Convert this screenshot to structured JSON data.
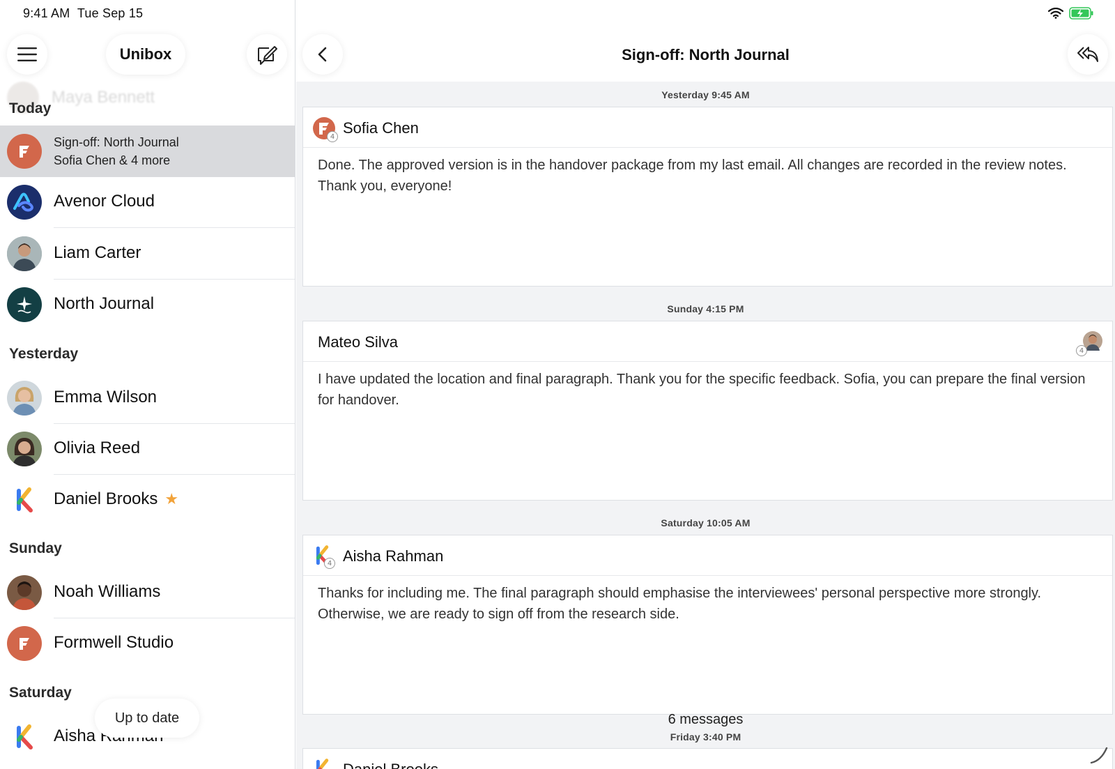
{
  "status_bar": {
    "time": "9:41 AM",
    "date": "Tue Sep 15",
    "wifi_icon": "wifi-icon",
    "battery_icon": "battery-charging-icon"
  },
  "sidebar": {
    "title": "Unibox",
    "menu_icon": "hamburger-menu-icon",
    "compose_icon": "compose-icon",
    "ghost_row_name": "Maya Bennett",
    "sections": {
      "today": "Today",
      "yesterday": "Yesterday",
      "sunday": "Sunday",
      "saturday": "Saturday"
    },
    "selected_thread": {
      "subject": "Sign-off: North Journal",
      "participants": "Sofia Chen & 4 more"
    },
    "items": [
      "Avenor Cloud",
      "Liam Carter",
      "North Journal",
      "Emma Wilson",
      "Olivia Reed",
      "Daniel Brooks",
      "Noah Williams",
      "Formwell Studio",
      "Aisha Rahman"
    ],
    "toast": "Up to date"
  },
  "detail": {
    "title": "Sign-off: North Journal",
    "back_icon": "chevron-left-icon",
    "reply_icon": "reply-all-icon",
    "messages": [
      {
        "timestamp": "Yesterday 9:45 AM",
        "sender": "Sofia Chen",
        "badge": "4",
        "body": "Done. The approved version is in the handover package from my last email. All changes are recorded in the review notes. Thank you, everyone!"
      },
      {
        "timestamp": "Sunday 4:15 PM",
        "sender": "Mateo Silva",
        "badge": "4",
        "body": "I have updated the location and final paragraph. Thank you for the specific feedback. Sofia, you can prepare the final version for handover."
      },
      {
        "timestamp": "Saturday 10:05 AM",
        "sender": "Aisha Rahman",
        "badge": "4",
        "body": "Thanks for including me. The final paragraph should emphasise the interviewees' personal perspective more strongly. Otherwise, we are ready to sign off from the research side."
      },
      {
        "timestamp": "Friday 3:40 PM",
        "sender": "Daniel Brooks"
      }
    ],
    "collapsed_count": "6 messages"
  }
}
